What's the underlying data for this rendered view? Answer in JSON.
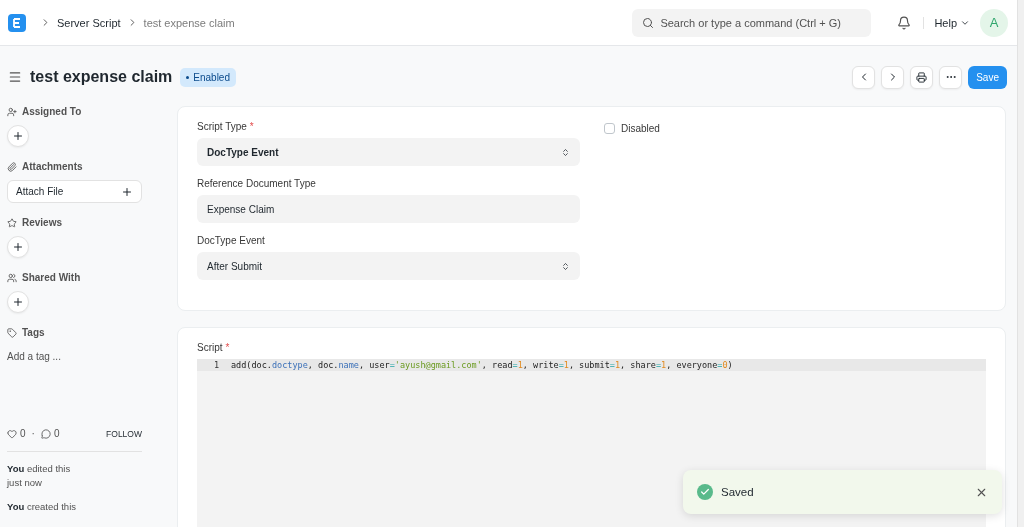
{
  "navbar": {
    "breadcrumbs": [
      {
        "label": "Server Script",
        "current": false
      },
      {
        "label": "test expense claim",
        "current": true
      }
    ],
    "search": {
      "placeholder": "Search or type a command (Ctrl + G)"
    },
    "help": "Help",
    "avatar": "A"
  },
  "header": {
    "title": "test expense claim",
    "status": "Enabled",
    "save": "Save"
  },
  "sidebar": {
    "sections": [
      {
        "kind": "add",
        "label": "Assigned To"
      },
      {
        "kind": "attach",
        "label": "Attachments",
        "button": "Attach File"
      },
      {
        "kind": "add",
        "label": "Reviews"
      },
      {
        "kind": "add",
        "label": "Shared With"
      },
      {
        "kind": "tags",
        "label": "Tags",
        "placeholder": "Add a tag ..."
      }
    ],
    "likes": "0",
    "separator": "·",
    "comments": "0",
    "follow": "FOLLOW",
    "activity": [
      {
        "who": "You",
        "text": "edited this just now"
      },
      {
        "who": "You",
        "text": "created this"
      }
    ]
  },
  "form": {
    "fields": [
      {
        "kind": "select",
        "label": "Script Type",
        "required_mark": "*",
        "value": "DocType Event",
        "bold": true
      },
      {
        "kind": "input",
        "label": "Reference Document Type",
        "value": "Expense Claim",
        "bold": false
      },
      {
        "kind": "select",
        "label": "DocType Event",
        "value": "After Submit",
        "bold": false
      }
    ],
    "disabled": {
      "label": "Disabled",
      "checked": false
    }
  },
  "script": {
    "label": "Script",
    "required_mark": "*",
    "lines": [
      {
        "number": "1",
        "tokens": [
          {
            "kind": "plain",
            "text": "add(doc."
          },
          {
            "kind": "prop",
            "text": "doctype"
          },
          {
            "kind": "plain",
            "text": ", doc."
          },
          {
            "kind": "prop",
            "text": "name"
          },
          {
            "kind": "plain",
            "text": ", user"
          },
          {
            "kind": "op",
            "text": "="
          },
          {
            "kind": "string",
            "text": "'ayush@gmail.com'"
          },
          {
            "kind": "plain",
            "text": ", read"
          },
          {
            "kind": "op",
            "text": "="
          },
          {
            "kind": "number",
            "text": "1"
          },
          {
            "kind": "plain",
            "text": ", write"
          },
          {
            "kind": "op",
            "text": "="
          },
          {
            "kind": "number",
            "text": "1"
          },
          {
            "kind": "plain",
            "text": ", submit"
          },
          {
            "kind": "op",
            "text": "="
          },
          {
            "kind": "number",
            "text": "1"
          },
          {
            "kind": "plain",
            "text": ", share"
          },
          {
            "kind": "op",
            "text": "="
          },
          {
            "kind": "number",
            "text": "1"
          },
          {
            "kind": "plain",
            "text": ", everyone"
          },
          {
            "kind": "op",
            "text": "="
          },
          {
            "kind": "number",
            "text": "0"
          },
          {
            "kind": "plain",
            "text": ")"
          }
        ]
      }
    ]
  },
  "toast": {
    "message": "Saved"
  }
}
